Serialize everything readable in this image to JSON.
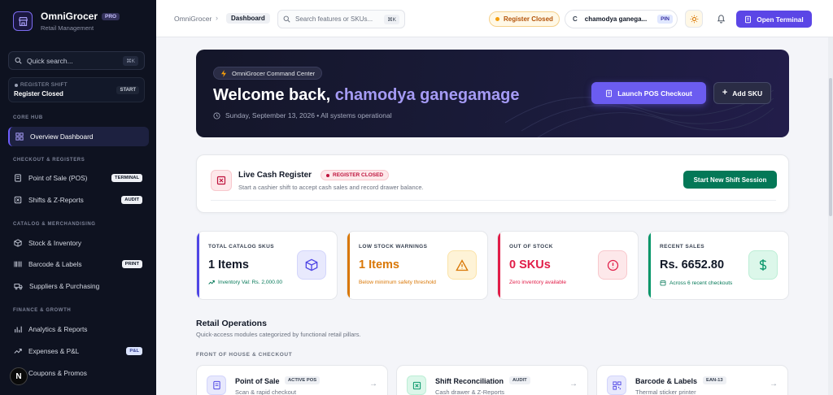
{
  "brand": {
    "name": "OmniGrocer",
    "badge": "PRO",
    "subtitle": "Retail Management"
  },
  "sidebar": {
    "quick_search": {
      "label": "Quick search...",
      "shortcut": "⌘K"
    },
    "register": {
      "title": "REGISTER SHIFT",
      "status": "Register Closed",
      "action": "START"
    },
    "sections": [
      {
        "label": "CORE HUB"
      },
      {
        "label": "CHECKOUT & REGISTERS"
      },
      {
        "label": "CATALOG & MERCHANDISING"
      },
      {
        "label": "FINANCE & GROWTH"
      }
    ],
    "items": [
      {
        "label": "Overview Dashboard",
        "badge": ""
      },
      {
        "label": "Point of Sale (POS)",
        "badge": "TERMINAL"
      },
      {
        "label": "Shifts & Z-Reports",
        "badge": "AUDIT"
      },
      {
        "label": "Stock & Inventory",
        "badge": ""
      },
      {
        "label": "Barcode & Labels",
        "badge": "PRINT"
      },
      {
        "label": "Suppliers & Purchasing",
        "badge": ""
      },
      {
        "label": "Analytics & Reports",
        "badge": ""
      },
      {
        "label": "Expenses & P&L",
        "badge": "P&L"
      },
      {
        "label": "Coupons & Promos",
        "badge": ""
      }
    ],
    "avatar": "N"
  },
  "topbar": {
    "breadcrumb_root": "OmniGrocer",
    "breadcrumb_current": "Dashboard",
    "search_placeholder": "Search features or SKUs...",
    "search_shortcut": "⌘K",
    "register_status": "Register Closed",
    "user_initial": "C",
    "user_name": "chamodya ganega...",
    "user_badge": "PIN",
    "open_terminal": "Open Terminal"
  },
  "hero": {
    "pill": "OmniGrocer Command Center",
    "welcome": "Welcome back,",
    "user": "chamodya ganegamage",
    "subtitle": "Sunday, September 13, 2026 • All systems operational",
    "launch": "Launch POS Checkout",
    "add_sku": "Add SKU"
  },
  "register_card": {
    "title": "Live Cash Register",
    "status": "REGISTER CLOSED",
    "subtitle": "Start a cashier shift to accept cash sales and record drawer balance.",
    "action": "Start New Shift Session"
  },
  "stats": [
    {
      "label": "TOTAL CATALOG SKUS",
      "value": "1 Items",
      "note": "Inventory Val: Rs. 2,000.00",
      "accent": "#4f46e5"
    },
    {
      "label": "LOW STOCK WARNINGS",
      "value": "1 Items",
      "note": "Below minimum safety threshold",
      "accent": "#d97706"
    },
    {
      "label": "OUT OF STOCK",
      "value": "0 SKUs",
      "note": "Zero inventory available",
      "accent": "#e11d48"
    },
    {
      "label": "RECENT SALES",
      "value": "Rs. 6652.80",
      "note": "Across 6 recent checkouts",
      "accent": "#059669"
    }
  ],
  "operations": {
    "title": "Retail Operations",
    "subtitle": "Quick-access modules categorized by functional retail pillars.",
    "category": "FRONT OF HOUSE & CHECKOUT",
    "modules": [
      {
        "title": "Point of Sale",
        "badge": "ACTIVE POS",
        "subtitle": "Scan & rapid checkout"
      },
      {
        "title": "Shift Reconciliation",
        "badge": "AUDIT",
        "subtitle": "Cash drawer & Z-Reports"
      },
      {
        "title": "Barcode & Labels",
        "badge": "EAN-13",
        "subtitle": "Thermal sticker printer"
      }
    ]
  },
  "colors": {
    "primary": "#5b46e6",
    "success": "#047857",
    "danger": "#be123c",
    "warning": "#d97706"
  }
}
